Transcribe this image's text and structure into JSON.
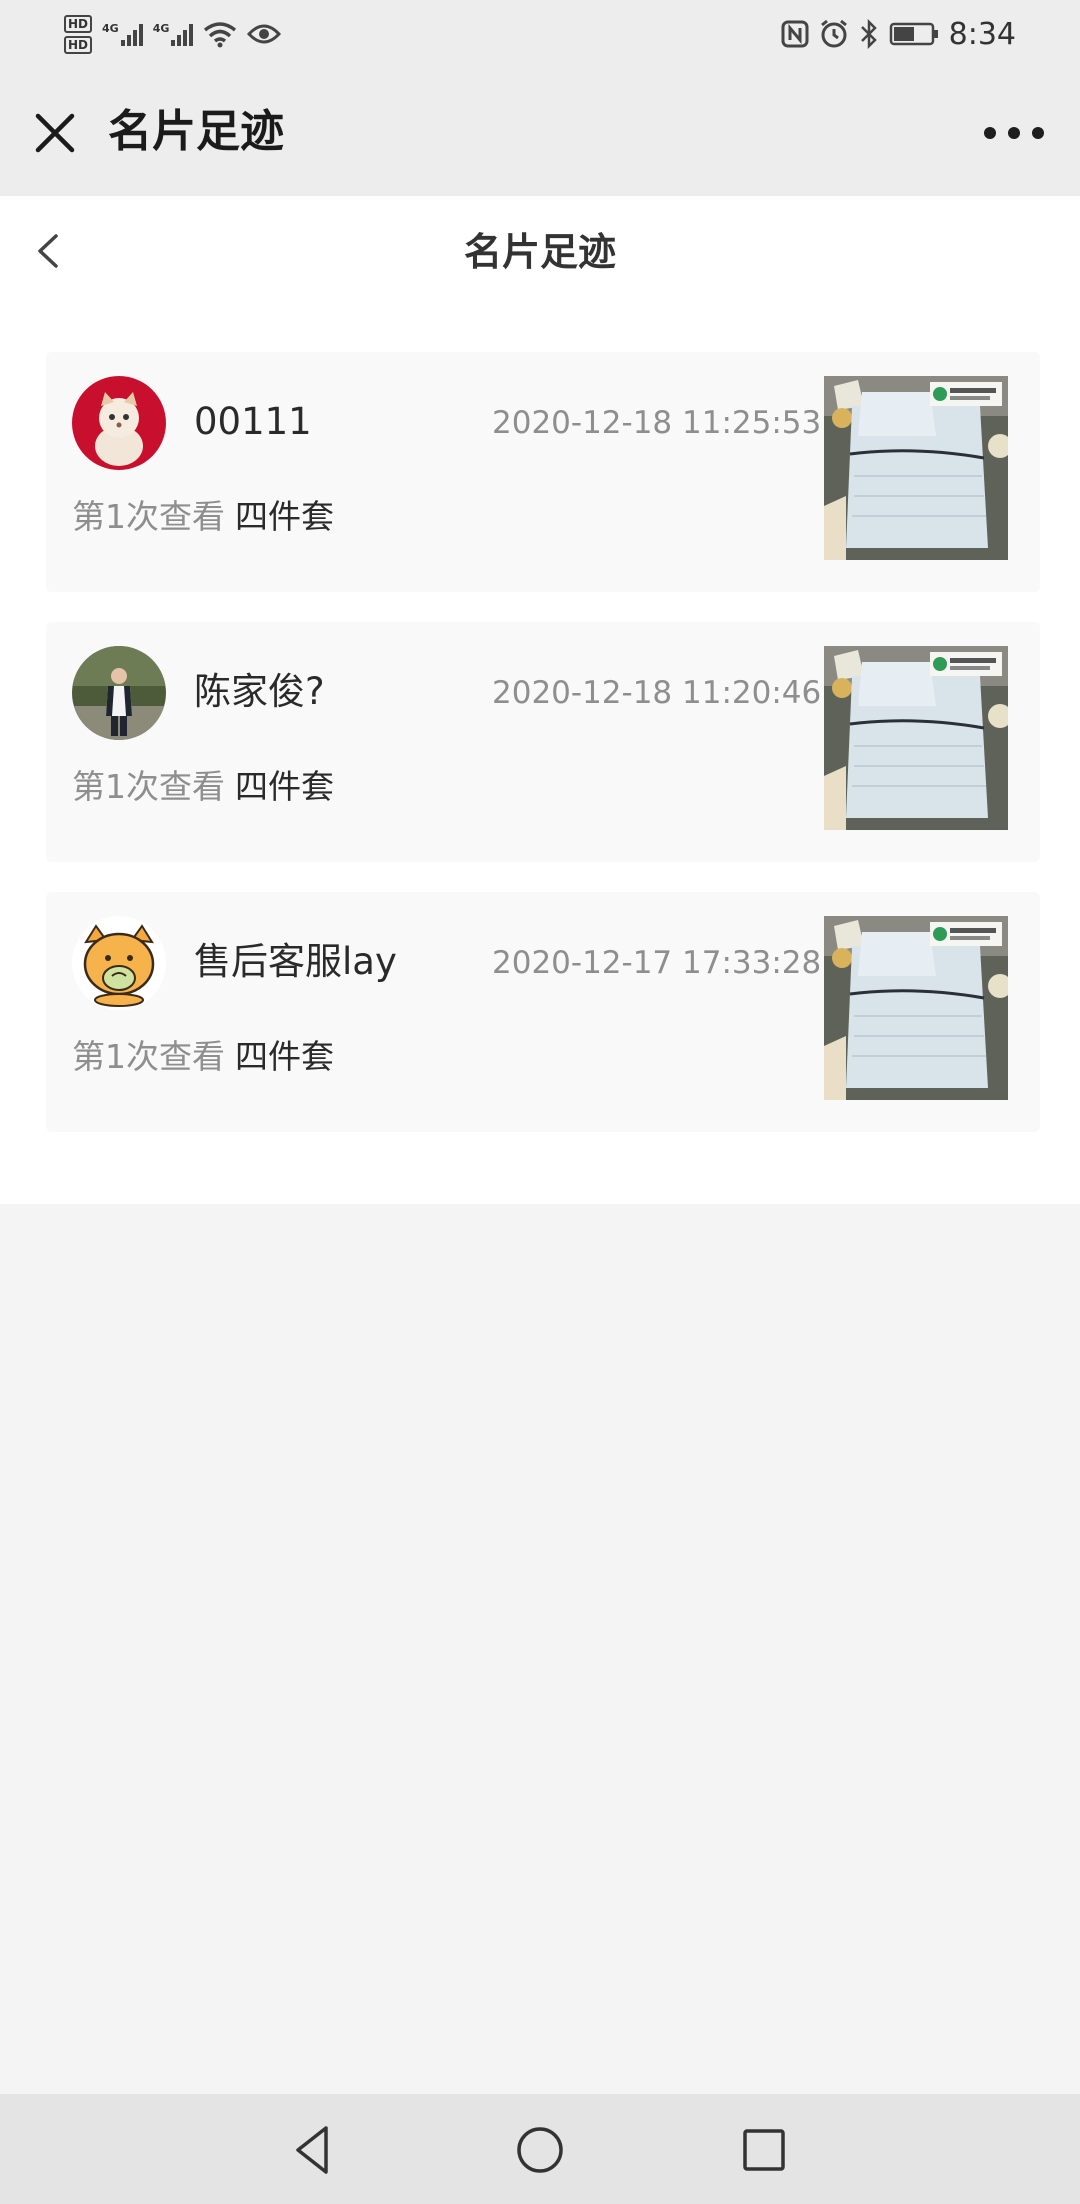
{
  "status_bar": {
    "time": "8:34",
    "hd_labels": [
      "HD",
      "HD"
    ],
    "network_labels": [
      "4G",
      "4G"
    ],
    "icons": [
      "hd-icon",
      "signal-icon",
      "wifi-icon",
      "eye-icon",
      "nfc-icon",
      "alarm-icon",
      "bluetooth-icon",
      "battery-icon"
    ]
  },
  "title_bar": {
    "title": "名片足迹",
    "close_icon": "close-icon",
    "more_icon": "more-dots-icon"
  },
  "page": {
    "header_title": "名片足迹",
    "back_icon": "chevron-left-icon"
  },
  "records": [
    {
      "name": "00111",
      "time": "2020-12-18 11:25:53",
      "view_count": "第1次查看",
      "product": "四件套",
      "avatar": "kitten-avatar"
    },
    {
      "name": "陈家俊?",
      "time": "2020-12-18 11:20:46",
      "view_count": "第1次查看",
      "product": "四件套",
      "avatar": "person-avatar"
    },
    {
      "name": "售后客服lay",
      "time": "2020-12-17 17:33:28",
      "view_count": "第1次查看",
      "product": "四件套",
      "avatar": "cartoon-avatar"
    }
  ],
  "nav_bar": {
    "icons": [
      "back-triangle-icon",
      "home-circle-icon",
      "recents-square-icon"
    ]
  },
  "colors": {
    "background": "#f4f4f5",
    "title_bar": "#ededed",
    "card": "#f9f9f9",
    "secondary_text": "#8e8e8e"
  }
}
